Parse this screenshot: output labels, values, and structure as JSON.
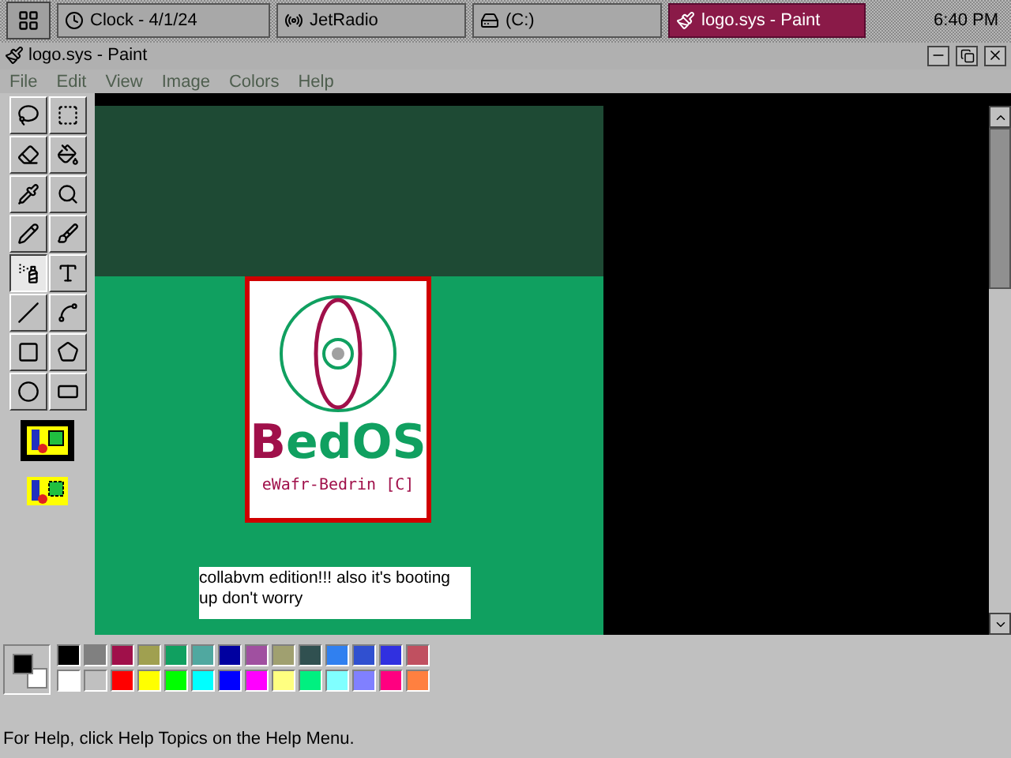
{
  "taskbar": {
    "buttons": [
      {
        "label": "Clock - 4/1/24",
        "selected": false
      },
      {
        "label": "JetRadio",
        "selected": false
      },
      {
        "label": "(C:)",
        "selected": false
      },
      {
        "label": "logo.sys - Paint",
        "selected": true
      }
    ],
    "clock": "6:40 PM"
  },
  "window": {
    "title": "logo.sys - Paint"
  },
  "menu": [
    {
      "label": "File",
      "disabled": true
    },
    {
      "label": "Edit",
      "disabled": true
    },
    {
      "label": "View",
      "disabled": true
    },
    {
      "label": "Image",
      "disabled": true
    },
    {
      "label": "Colors",
      "disabled": true
    },
    {
      "label": "Help",
      "disabled": true
    }
  ],
  "tools": [
    {
      "kind": "free-select",
      "selected": false
    },
    {
      "kind": "select",
      "selected": false
    },
    {
      "kind": "eraser",
      "selected": false
    },
    {
      "kind": "fill",
      "selected": false
    },
    {
      "kind": "pick",
      "selected": false
    },
    {
      "kind": "magnifier",
      "selected": false
    },
    {
      "kind": "pencil",
      "selected": false
    },
    {
      "kind": "brush",
      "selected": false
    },
    {
      "kind": "airbrush",
      "selected": true
    },
    {
      "kind": "text",
      "selected": false
    },
    {
      "kind": "line",
      "selected": false
    },
    {
      "kind": "curve",
      "selected": false
    },
    {
      "kind": "rectangle",
      "selected": false
    },
    {
      "kind": "polygon",
      "selected": false
    },
    {
      "kind": "ellipse",
      "selected": false
    },
    {
      "kind": "rounded-rectangle",
      "selected": false
    }
  ],
  "tool_options": [
    {
      "kind": "opaque",
      "selected": true
    },
    {
      "kind": "transparent",
      "selected": false
    }
  ],
  "canvas": {
    "logo_name": "BedOS",
    "logo_credit": "eWafr-Bedrin [C]",
    "caption": "collabvm edition!!! also it's booting up don't worry"
  },
  "palette": {
    "colors": [
      {
        "color": "#000000"
      },
      {
        "color": "#808080"
      },
      {
        "color": "#a0104a"
      },
      {
        "color": "#a0a050"
      },
      {
        "color": "#10a060"
      },
      {
        "color": "#50a8a0"
      },
      {
        "color": "#0000a0"
      },
      {
        "color": "#a050a0"
      },
      {
        "color": "#a0a070"
      },
      {
        "color": "#305050"
      },
      {
        "color": "#3080f0"
      },
      {
        "color": "#3050d0"
      },
      {
        "color": "#3030e0"
      },
      {
        "color": "#c05060"
      },
      {
        "color": "#ffffff"
      },
      {
        "color": "#c0c0c0"
      },
      {
        "color": "#ff0000"
      },
      {
        "color": "#ffff00"
      },
      {
        "color": "#00ff00"
      },
      {
        "color": "#00ffff"
      },
      {
        "color": "#0000ff"
      },
      {
        "color": "#ff00ff"
      },
      {
        "color": "#ffff80"
      },
      {
        "color": "#00f080"
      },
      {
        "color": "#80ffff"
      },
      {
        "color": "#8080ff"
      },
      {
        "color": "#ff0080"
      },
      {
        "color": "#ff8040"
      }
    ]
  },
  "status_bar": {
    "text": "For Help, click Help Topics on the Help Menu."
  }
}
